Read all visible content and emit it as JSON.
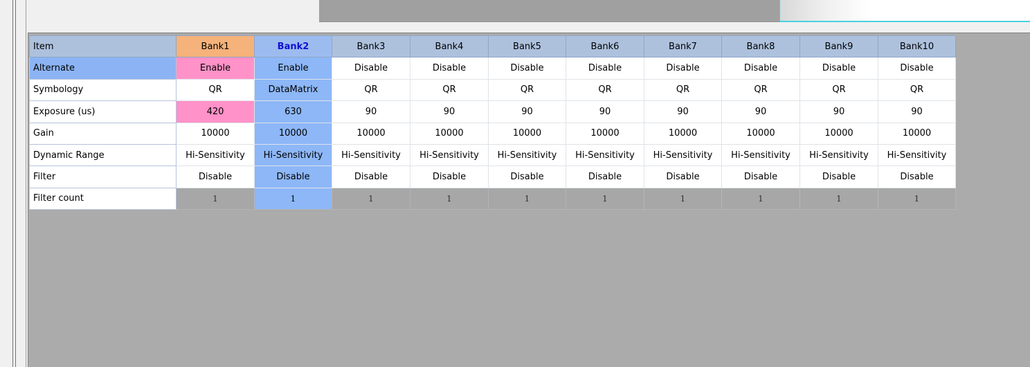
{
  "table": {
    "columns": [
      "Item",
      "Bank1",
      "Bank2",
      "Bank3",
      "Bank4",
      "Bank5",
      "Bank6",
      "Bank7",
      "Bank8",
      "Bank9",
      "Bank10"
    ],
    "rows": [
      {
        "label": "Alternate",
        "values": [
          "Enable",
          "Enable",
          "Disable",
          "Disable",
          "Disable",
          "Disable",
          "Disable",
          "Disable",
          "Disable",
          "Disable"
        ]
      },
      {
        "label": "Symbology",
        "values": [
          "QR",
          "DataMatrix",
          "QR",
          "QR",
          "QR",
          "QR",
          "QR",
          "QR",
          "QR",
          "QR"
        ]
      },
      {
        "label": "Exposure (us)",
        "values": [
          "420",
          "630",
          "90",
          "90",
          "90",
          "90",
          "90",
          "90",
          "90",
          "90"
        ]
      },
      {
        "label": "Gain",
        "values": [
          "10000",
          "10000",
          "10000",
          "10000",
          "10000",
          "10000",
          "10000",
          "10000",
          "10000",
          "10000"
        ]
      },
      {
        "label": "Dynamic Range",
        "values": [
          "Hi-Sensitivity",
          "Hi-Sensitivity",
          "Hi-Sensitivity",
          "Hi-Sensitivity",
          "Hi-Sensitivity",
          "Hi-Sensitivity",
          "Hi-Sensitivity",
          "Hi-Sensitivity",
          "Hi-Sensitivity",
          "Hi-Sensitivity"
        ]
      },
      {
        "label": "Filter",
        "values": [
          "Disable",
          "Disable",
          "Disable",
          "Disable",
          "Disable",
          "Disable",
          "Disable",
          "Disable",
          "Disable",
          "Disable"
        ]
      },
      {
        "label": "Filter count",
        "values": [
          "1",
          "1",
          "1",
          "1",
          "1",
          "1",
          "1",
          "1",
          "1",
          "1"
        ]
      }
    ]
  },
  "colors": {
    "bank1_header": "#f5b27a",
    "bank2_header": "#9cbcf0",
    "bank2_text": "#1010d0",
    "highlight_pink": "#ff92c8",
    "highlight_blue": "#8db7f7",
    "disabled_gray": "#a7a7a7"
  }
}
